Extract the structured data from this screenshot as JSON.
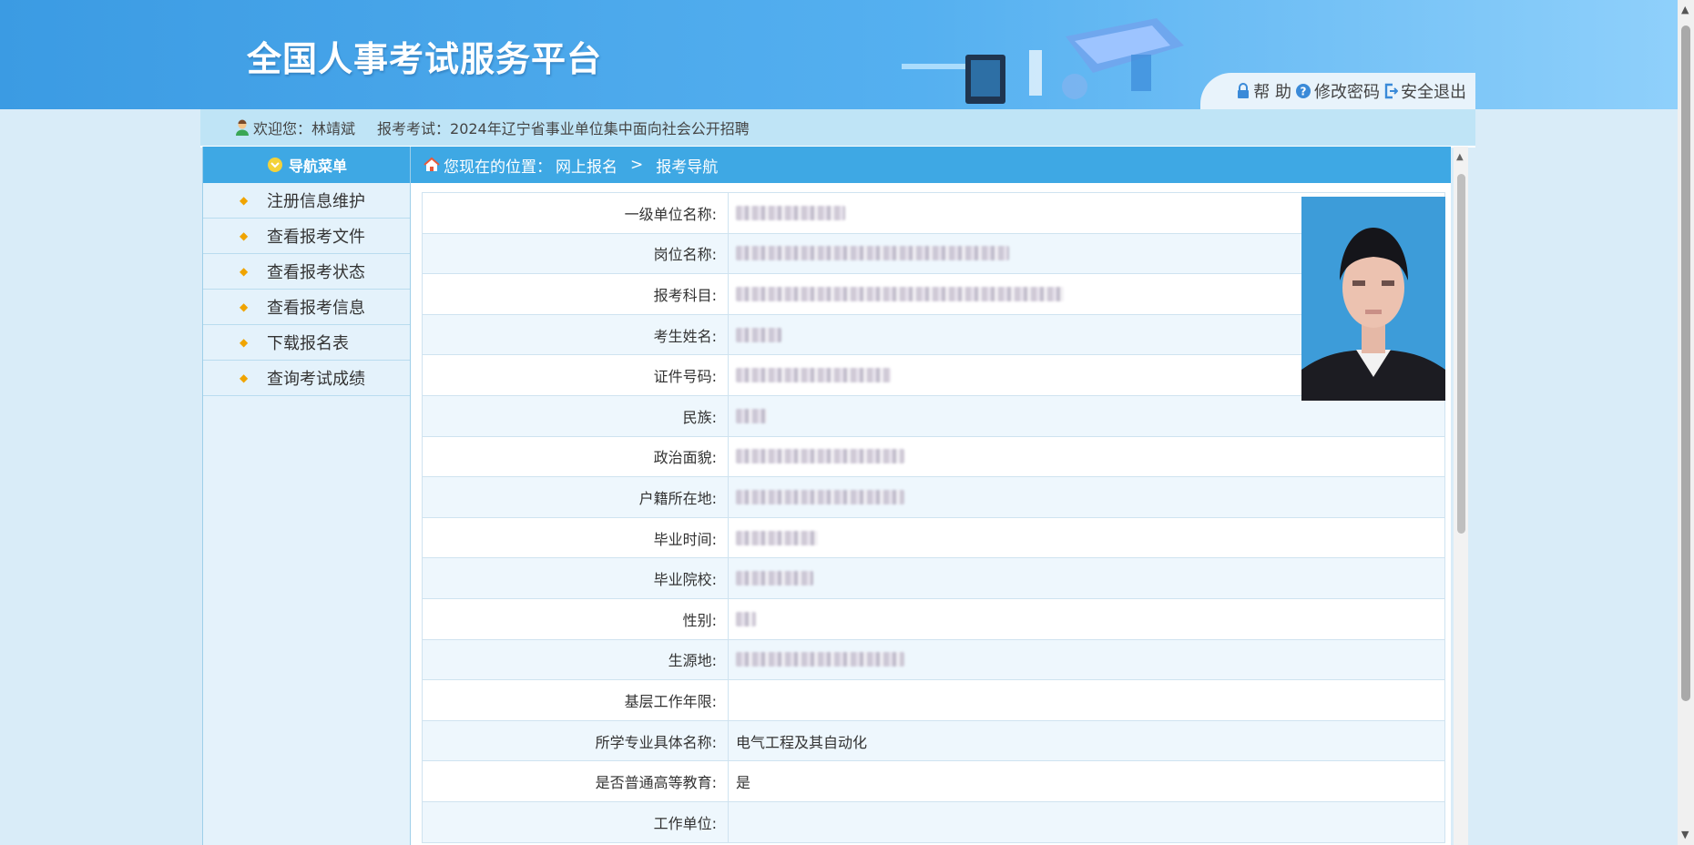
{
  "header": {
    "title": "全国人事考试服务平台",
    "links": [
      {
        "icon": "lock-icon",
        "label": "帮 助"
      },
      {
        "icon": "question-icon",
        "label": "修改密码"
      },
      {
        "icon": "logout-icon",
        "label": "安全退出"
      }
    ]
  },
  "welcome": {
    "greeting": "欢迎您：林靖斌",
    "exam": "报考考试：2024年辽宁省事业单位集中面向社会公开招聘"
  },
  "sidebar": {
    "title": "导航菜单",
    "items": [
      {
        "label": "注册信息维护"
      },
      {
        "label": "查看报考文件"
      },
      {
        "label": "查看报考状态"
      },
      {
        "label": "查看报考信息"
      },
      {
        "label": "下载报名表"
      },
      {
        "label": "查询考试成绩"
      }
    ]
  },
  "breadcrumb": {
    "prefix": "您现在的位置：",
    "level1": "网上报名",
    "separator": ">",
    "level2": "报考导航"
  },
  "form": {
    "rows": [
      {
        "label": "一级单位名称:",
        "value": ""
      },
      {
        "label": "岗位名称:",
        "value": ""
      },
      {
        "label": "报考科目:",
        "value": ""
      },
      {
        "label": "考生姓名:",
        "value": ""
      },
      {
        "label": "证件号码:",
        "value": ""
      },
      {
        "label": "民族:",
        "value": ""
      },
      {
        "label": "政治面貌:",
        "value": ""
      },
      {
        "label": "户籍所在地:",
        "value": ""
      },
      {
        "label": "毕业时间:",
        "value": ""
      },
      {
        "label": "毕业院校:",
        "value": ""
      },
      {
        "label": "性别:",
        "value": ""
      },
      {
        "label": "生源地:",
        "value": ""
      },
      {
        "label": "基层工作年限:",
        "value": ""
      },
      {
        "label": "所学专业具体名称:",
        "value": "电气工程及其自动化"
      },
      {
        "label": "是否普通高等教育:",
        "value": "是"
      },
      {
        "label": "工作单位:",
        "value": ""
      }
    ]
  }
}
